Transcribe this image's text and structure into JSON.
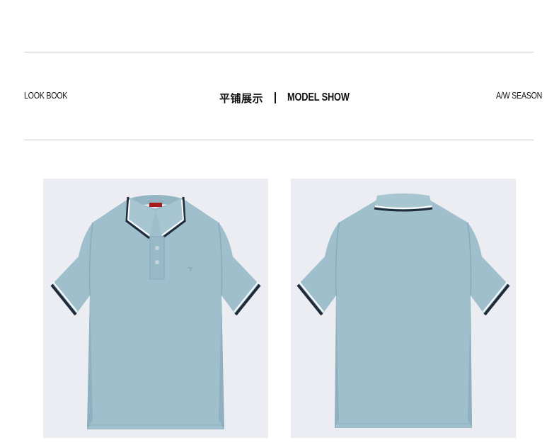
{
  "header": {
    "left_label": "LOOK BOOK",
    "center_cn": "平铺展示",
    "center_en": "MODEL SHOW",
    "right_label": "A/W SEASON"
  },
  "images": [
    {
      "name": "polo-front",
      "view": "front"
    },
    {
      "name": "polo-back",
      "view": "back"
    }
  ],
  "colors": {
    "background": "#ffffff",
    "rule": "#c9c9c9",
    "panel": "#ecedf2",
    "shirt": "#9fbfcc",
    "shirt_shadow": "#8fb0bf",
    "tipping_white": "#ffffff",
    "tipping_navy": "#1f2a3a"
  }
}
